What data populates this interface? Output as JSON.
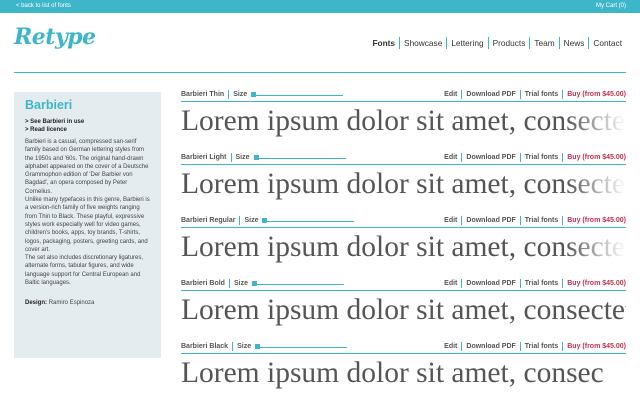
{
  "topbar": {
    "back_label": "< back to list of fonts",
    "cart_label": "My Cart (0)"
  },
  "logo": {
    "text": "Retype"
  },
  "nav": {
    "items": [
      "Fonts",
      "Showcase",
      "Lettering",
      "Products",
      "Team",
      "News",
      "Contact"
    ]
  },
  "sidebar": {
    "title": "Barbieri",
    "links": [
      "> See Barbieri in use",
      "> Read licence"
    ],
    "description": "Barbieri is a casual, compressed san-serif family based on German lettering styles from the 1950s and '60s. The original hand-drawn alphabet appeared on the cover of a Deutsche Grammophon edition of 'Der Barbier von Bagdad', an opera composed by Peter Cornelius.",
    "description2": "Unlike many typefaces in this genre, Barbieri is a version-rich family of five weights ranging from Thin to Black. These playful, expressive styles work especially well for video games, children's books, apps, toy brands, T-shirts, logos, packaging, posters, greeting cards, and cover art.",
    "description3": "The set also includes discretionary ligatures, alternate forms, tabular figures, and wide language support for Central European and Baltic languages.",
    "design_label": "Design:",
    "design_value": "Ramiro Espinoza"
  },
  "font_controls": {
    "size_label": "Size",
    "edit_label": "Edit",
    "pdf_label": "Download PDF",
    "trial_label": "Trial fonts",
    "buy_label": "Buy (from $45.00)"
  },
  "fonts": [
    {
      "name": "Barbieri Thin",
      "sample": "Lorem ipsum dolor sit amet, consectetur a"
    },
    {
      "name": "Barbieri Light",
      "sample": "Lorem ipsum dolor sit amet, consectetur a"
    },
    {
      "name": "Barbieri Regular",
      "sample": "Lorem ipsum dolor sit amet, consectetur a"
    },
    {
      "name": "Barbieri Bold",
      "sample": "Lorem ipsum dolor sit amet, consectetur"
    },
    {
      "name": "Barbieri Black",
      "sample": "Lorem ipsum dolor sit amet, consec"
    }
  ],
  "colors": {
    "accent": "#3eb6c9",
    "buy": "#c4314b",
    "sidebar_bg": "#e5ecf0"
  }
}
